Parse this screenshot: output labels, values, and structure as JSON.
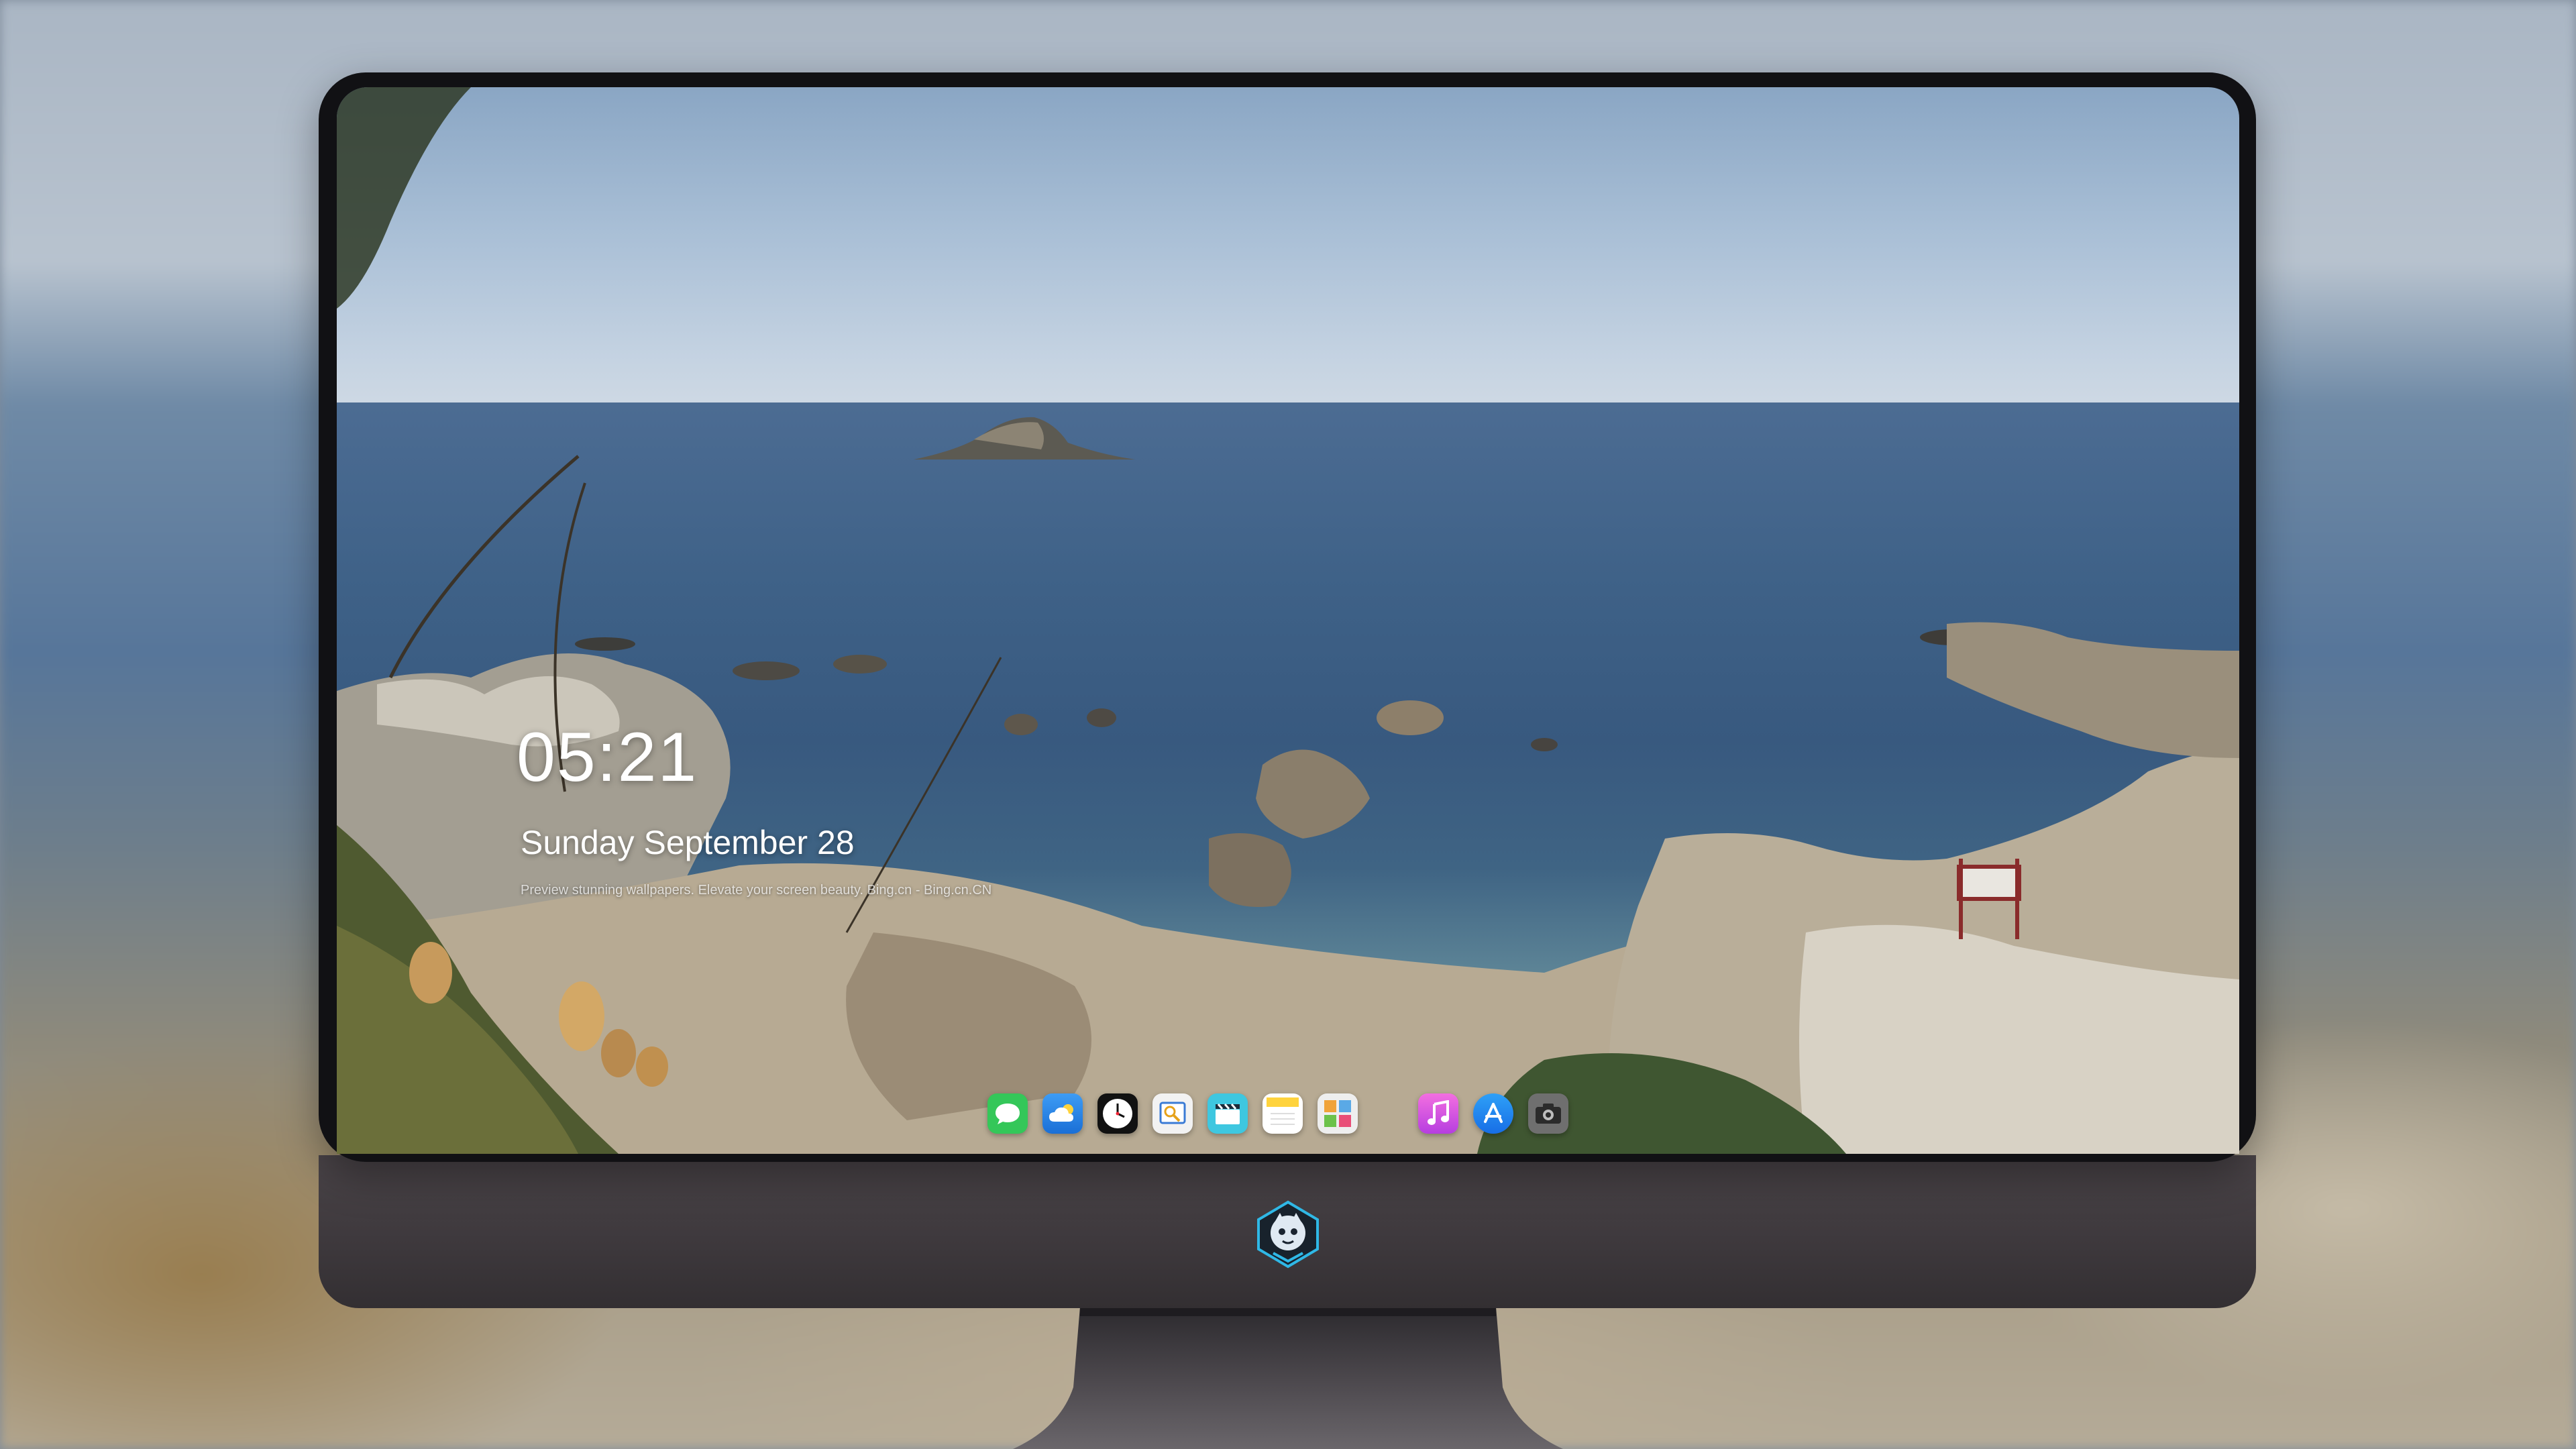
{
  "lockscreen": {
    "time": "05:21",
    "date": "Sunday September  28",
    "preview_note": "Preview stunning wallpapers. Elevate your screen beauty. Bing.cn - Bing.cn.CN"
  },
  "dock": {
    "apps": [
      {
        "name": "Messages",
        "icon": "message-bubble-icon",
        "color": "#34c759"
      },
      {
        "name": "Weather",
        "icon": "weather-cloud-icon",
        "color": "#2f8cf0"
      },
      {
        "name": "Clock",
        "icon": "clock-icon",
        "color": "#ffffff"
      },
      {
        "name": "Preview",
        "icon": "preview-icon",
        "color": "#f2f2f2"
      },
      {
        "name": "Clips",
        "icon": "clapperboard-icon",
        "color": "#3ec7e0"
      },
      {
        "name": "Notes",
        "icon": "notes-icon",
        "color": "#ffd33d"
      },
      {
        "name": "Photo Browser",
        "icon": "photo-grid-icon",
        "color": "#eeeeee"
      },
      {
        "name": "Music",
        "icon": "music-note-icon",
        "color": "#e84bd8"
      },
      {
        "name": "App Store",
        "icon": "app-store-icon",
        "color": "#1e8ef0"
      },
      {
        "name": "Camera",
        "icon": "camera-icon",
        "color": "#6f6f6f"
      }
    ]
  },
  "colors": {
    "bezel": "#111114",
    "chin": "#3d383c",
    "logo_accent": "#2fb8e6"
  }
}
